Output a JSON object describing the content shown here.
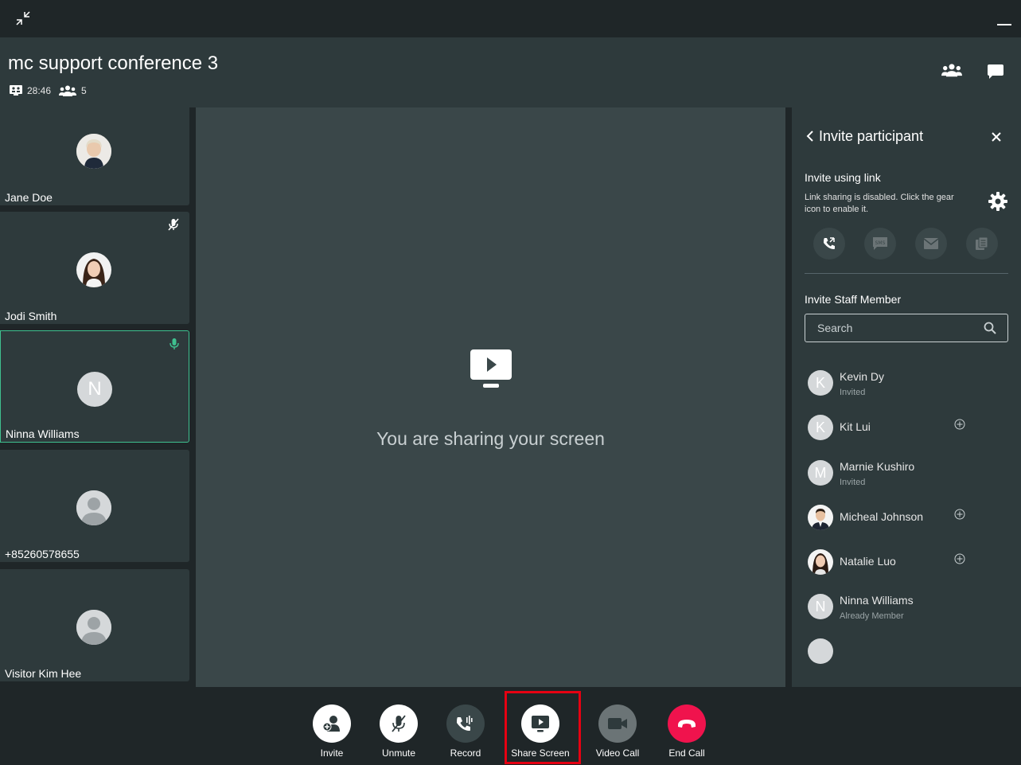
{
  "window": {
    "shrink_icon": "shrink-arrows-icon",
    "minimize_icon": "minimize-icon"
  },
  "header": {
    "title": "mc support conference 3",
    "duration": "28:46",
    "participant_count": "5",
    "participants_icon": "people-icon",
    "chat_icon": "chat-bubble-icon"
  },
  "participants": [
    {
      "name": "Jane Doe",
      "avatar": "photo",
      "mic": "none"
    },
    {
      "name": "Jodi Smith",
      "avatar": "photo",
      "mic": "muted"
    },
    {
      "name": "Ninna Williams",
      "avatar": "N",
      "mic": "speaking",
      "active": true
    },
    {
      "name": "+85260578655",
      "avatar": "generic",
      "mic": "none"
    },
    {
      "name": "Visitor Kim Hee",
      "avatar": "generic",
      "mic": "none"
    }
  ],
  "stage": {
    "message": "You are sharing your screen",
    "icon": "screen-share-icon"
  },
  "invite_panel": {
    "title": "Invite participant",
    "link_section": "Invite using link",
    "link_hint": "Link sharing is disabled. Click the gear icon to enable it.",
    "share_options": [
      "phone-icon",
      "sms-icon",
      "email-icon",
      "copy-icon"
    ],
    "staff_section": "Invite Staff Member",
    "search_placeholder": "Search",
    "staff": [
      {
        "name": "Kevin Dy",
        "status": "Invited",
        "avatar": "K"
      },
      {
        "name": "Kit Lui",
        "status": "",
        "avatar": "K",
        "addable": true
      },
      {
        "name": "Marnie Kushiro",
        "status": "Invited",
        "avatar": "M"
      },
      {
        "name": "Micheal Johnson",
        "status": "",
        "avatar": "photo",
        "addable": true
      },
      {
        "name": "Natalie Luo",
        "status": "",
        "avatar": "photo",
        "addable": true
      },
      {
        "name": "Ninna Williams",
        "status": "Already Member",
        "avatar": "N"
      }
    ]
  },
  "controls": [
    {
      "label": "Invite",
      "icon": "add-user-icon",
      "color": "#ffffff"
    },
    {
      "label": "Unmute",
      "icon": "mic-off-icon",
      "color": "#ffffff"
    },
    {
      "label": "Record",
      "icon": "record-call-icon",
      "color": "#3a4749"
    },
    {
      "label": "Share Screen",
      "icon": "screen-share-icon",
      "color": "#ffffff"
    },
    {
      "label": "Video Call",
      "icon": "video-camera-icon",
      "color": "#6b7476"
    },
    {
      "label": "End Call",
      "icon": "hang-up-icon",
      "color": "#f0134d"
    }
  ],
  "colors": {
    "accent_green": "#3fc08f",
    "end_call": "#f0134d",
    "highlight": "#e60012"
  }
}
